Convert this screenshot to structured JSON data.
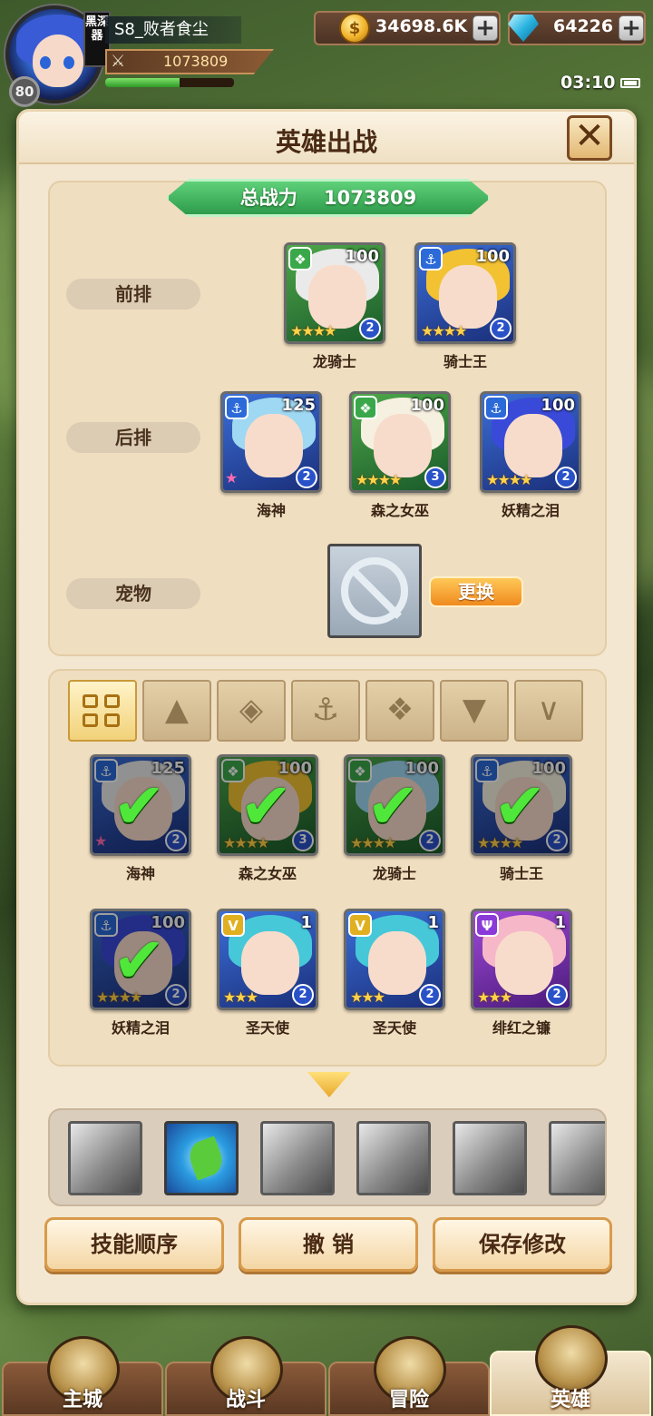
{
  "player": {
    "name": "S8_败者食尘",
    "level": "80",
    "vip_tag": "黑深器",
    "power": "1073809",
    "exp_fraction": 0.58
  },
  "resources": {
    "gold": "34698.6K",
    "gems": "64226"
  },
  "clock": "03:10",
  "panel": {
    "title": "英雄出战",
    "close_label": "✕",
    "total_power_label": "总战力",
    "total_power": "1073809"
  },
  "lineup": {
    "front_label": "前排",
    "back_label": "后排",
    "pet_label": "宠物",
    "change_label": "更换",
    "front": [
      {
        "name": "龙骑士",
        "level": "100",
        "class": "beast",
        "stars": "★★★★",
        "awaken": "2"
      },
      {
        "name": "骑士王",
        "level": "100",
        "class": "water",
        "stars": "★★★★",
        "awaken": "2"
      }
    ],
    "back": [
      {
        "name": "海神",
        "level": "125",
        "class": "water",
        "stars": "★",
        "awaken": "2"
      },
      {
        "name": "森之女巫",
        "level": "100",
        "class": "beast",
        "stars": "★★★★",
        "awaken": "3"
      },
      {
        "name": "妖精之泪",
        "level": "100",
        "class": "water",
        "stars": "★★★★",
        "awaken": "2"
      }
    ]
  },
  "filters": [
    "all",
    "faction-1",
    "faction-2",
    "water",
    "beast",
    "light",
    "dark"
  ],
  "roster": [
    {
      "name": "海神",
      "level": "125",
      "class": "water",
      "stars": "★",
      "awaken": "2",
      "selected": true
    },
    {
      "name": "森之女巫",
      "level": "100",
      "class": "beast",
      "stars": "★★★★",
      "awaken": "3",
      "selected": true
    },
    {
      "name": "龙骑士",
      "level": "100",
      "class": "beast",
      "stars": "★★★★",
      "awaken": "2",
      "selected": true
    },
    {
      "name": "骑士王",
      "level": "100",
      "class": "water",
      "stars": "★★★★",
      "awaken": "2",
      "selected": true
    },
    {
      "name": "妖精之泪",
      "level": "100",
      "class": "water",
      "stars": "★★★★",
      "awaken": "2",
      "selected": true
    },
    {
      "name": "圣天使",
      "level": "1",
      "class": "light",
      "stars": "★★★",
      "awaken": "2",
      "selected": false
    },
    {
      "name": "圣天使",
      "level": "1",
      "class": "light",
      "stars": "★★★",
      "awaken": "2",
      "selected": false
    },
    {
      "name": "绯红之镰",
      "level": "1",
      "class": "dark",
      "stars": "★★★",
      "awaken": "2",
      "selected": false
    }
  ],
  "buttons": {
    "skill_order": "技能顺序",
    "undo": "撤 销",
    "save": "保存修改"
  },
  "nav": {
    "main_city": "主城",
    "battle": "战斗",
    "adventure": "冒险",
    "heroes": "英雄"
  }
}
